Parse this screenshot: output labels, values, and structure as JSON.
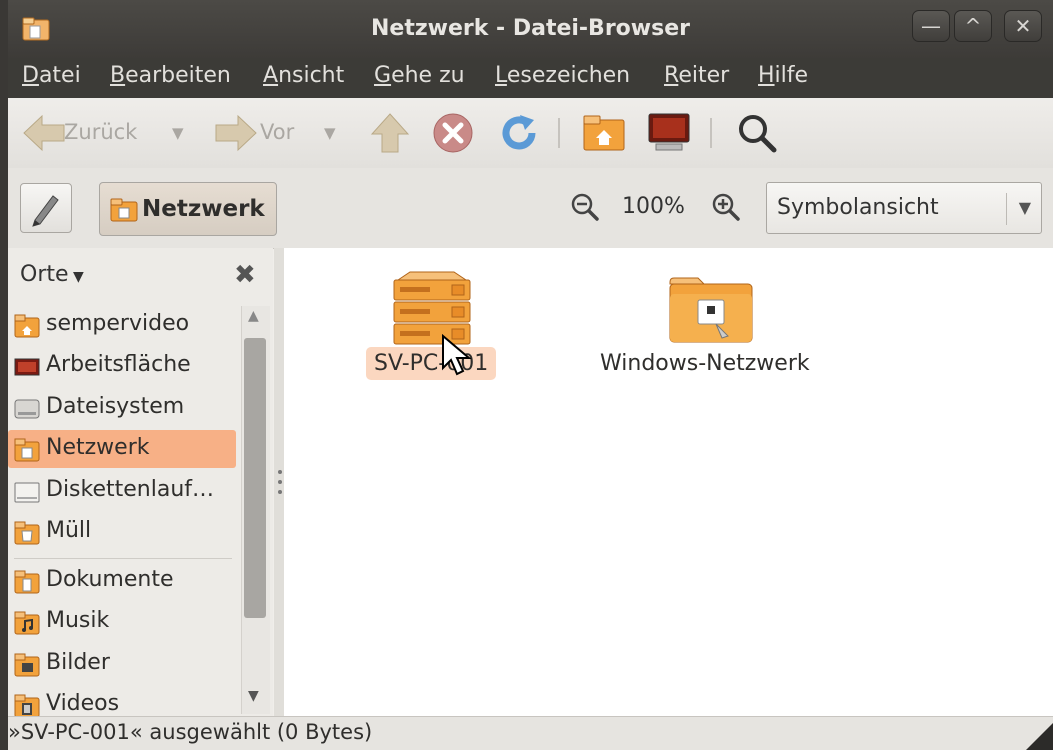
{
  "window": {
    "title": "Netzwerk - Datei-Browser",
    "controls": {
      "minimize": "—",
      "maximize": "^",
      "close": "✕"
    }
  },
  "menubar": [
    {
      "accel": "D",
      "rest": "atei"
    },
    {
      "accel": "B",
      "rest": "earbeiten"
    },
    {
      "accel": "A",
      "rest": "nsicht"
    },
    {
      "accel": "G",
      "rest": "ehe zu"
    },
    {
      "accel": "L",
      "rest": "esezeichen"
    },
    {
      "accel": "R",
      "rest": "eiter"
    },
    {
      "accel": "H",
      "rest": "ilfe"
    }
  ],
  "toolbar": {
    "back_label": "Zurück",
    "forward_label": "Vor",
    "icons": [
      "back-arrow-icon",
      "forward-arrow-icon",
      "up-arrow-icon",
      "stop-icon",
      "reload-icon",
      "home-folder-icon",
      "computer-icon",
      "search-icon"
    ]
  },
  "locationbar": {
    "path_button": "Netzwerk",
    "zoom_level": "100%",
    "view_mode": "Symbolansicht"
  },
  "sidebar": {
    "header": "Orte",
    "places": [
      {
        "label": "sempervideo",
        "icon": "home-folder-icon",
        "selected": false
      },
      {
        "label": "Arbeitsfläche",
        "icon": "desktop-icon",
        "selected": false
      },
      {
        "label": "Dateisystem",
        "icon": "drive-icon",
        "selected": false
      },
      {
        "label": "Netzwerk",
        "icon": "network-folder-icon",
        "selected": true
      },
      {
        "label": "Diskettenlauf…",
        "icon": "floppy-drive-icon",
        "selected": false
      },
      {
        "label": "Müll",
        "icon": "trash-icon",
        "selected": false
      }
    ],
    "bookmarks": [
      {
        "label": "Dokumente",
        "icon": "documents-folder-icon"
      },
      {
        "label": "Musik",
        "icon": "music-folder-icon"
      },
      {
        "label": "Bilder",
        "icon": "pictures-folder-icon"
      },
      {
        "label": "Videos",
        "icon": "videos-folder-icon"
      }
    ]
  },
  "content": {
    "items": [
      {
        "label": "SV-PC-001",
        "icon": "server-icon",
        "selected": true
      },
      {
        "label": "Windows-Netzwerk",
        "icon": "network-folder-icon",
        "selected": false
      }
    ]
  },
  "statusbar": {
    "text": "»SV-PC-001« ausgewählt (0 Bytes)"
  },
  "colors": {
    "selection": "#f7b086",
    "titlebar": "#3c3b37",
    "accent_orange": "#e8892c"
  }
}
